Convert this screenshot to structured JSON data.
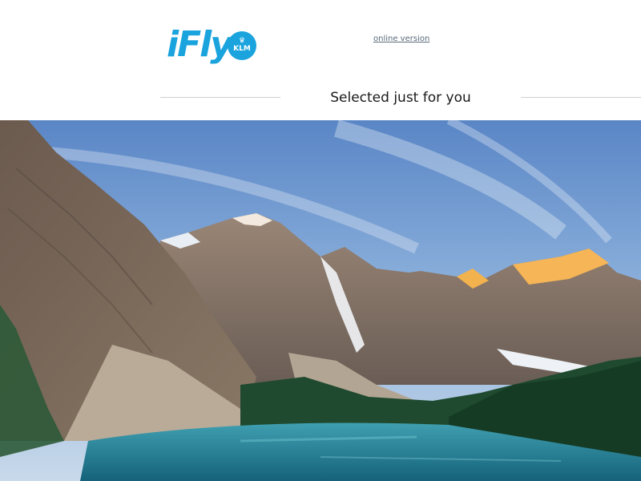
{
  "header": {
    "logo_text": "iFly",
    "logo_badge_text": "KLM",
    "online_version_label": "online version",
    "tagline": "Selected just for you"
  },
  "hero": {
    "description": "Mountain lake landscape with snow-capped peaks and turquoise water"
  },
  "colors": {
    "brand_blue": "#1aa3dd",
    "link_gray": "#5a6b7b",
    "divider": "#cfcfcf"
  }
}
